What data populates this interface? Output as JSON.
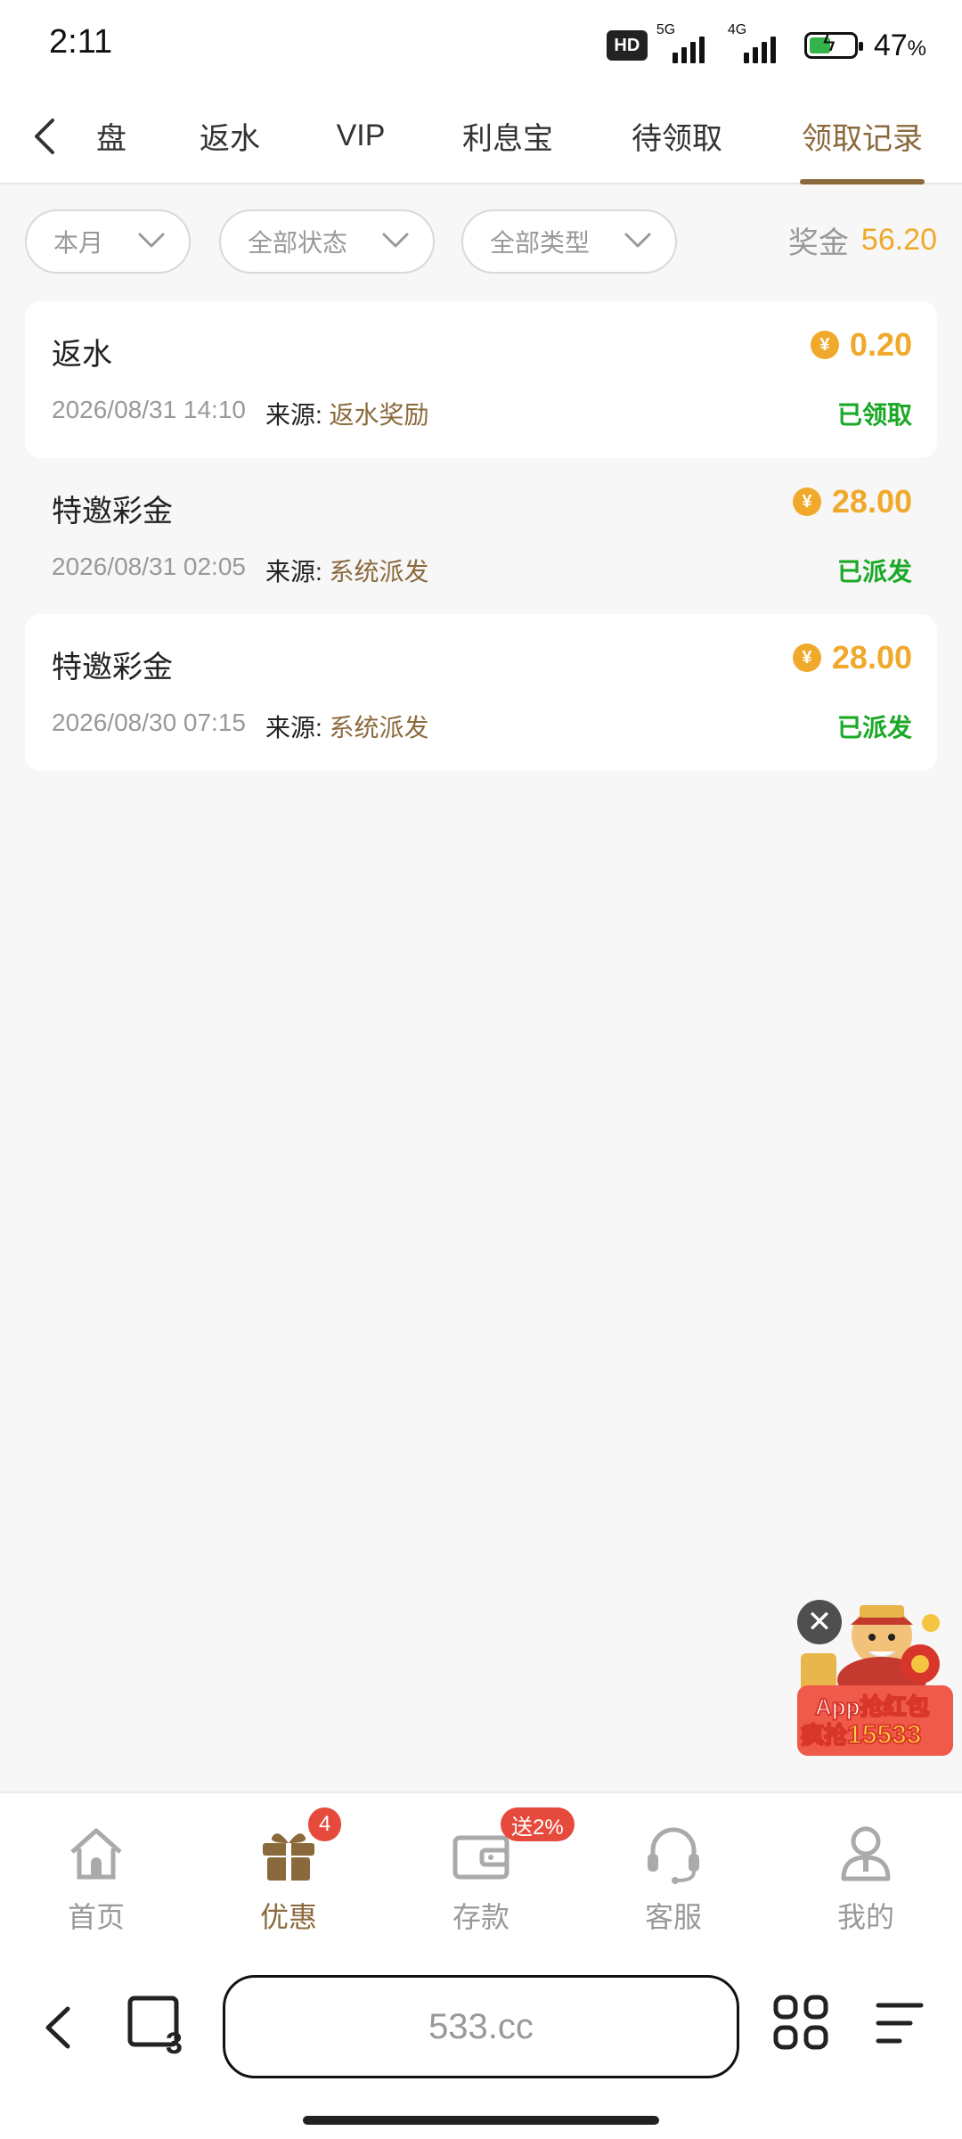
{
  "status_bar": {
    "time": "2:11",
    "hd_label": "HD",
    "net1": "5G",
    "net2": "4G",
    "battery_percent": "47",
    "battery_percent_unit": "%",
    "battery_level": 0.47
  },
  "tabs": [
    {
      "label": "盘",
      "active": false
    },
    {
      "label": "返水",
      "active": false
    },
    {
      "label": "VIP",
      "active": false
    },
    {
      "label": "利息宝",
      "active": false
    },
    {
      "label": "待领取",
      "active": false
    },
    {
      "label": "领取记录",
      "active": true
    }
  ],
  "filters": {
    "period": "本月",
    "status": "全部状态",
    "type": "全部类型",
    "bonus_label": "奖金",
    "bonus_value": "56.20"
  },
  "records": [
    {
      "title": "返水",
      "datetime": "2026/08/31 14:10",
      "source_label": "来源:",
      "source": "返水奖励",
      "amount": "0.20",
      "status": "已领取",
      "coin_symbol": "¥"
    },
    {
      "title": "特邀彩金",
      "datetime": "2026/08/31 02:05",
      "source_label": "来源:",
      "source": "系统派发",
      "amount": "28.00",
      "status": "已派发",
      "coin_symbol": "¥"
    },
    {
      "title": "特邀彩金",
      "datetime": "2026/08/30 07:15",
      "source_label": "来源:",
      "source": "系统派发",
      "amount": "28.00",
      "status": "已派发",
      "coin_symbol": "¥"
    }
  ],
  "promo": {
    "line1": "App抢红包",
    "line2_prefix": "疯抢",
    "line2_number": "15533",
    "close_glyph": "✕"
  },
  "bottom_nav": [
    {
      "label": "首页",
      "icon": "home-icon",
      "active": false
    },
    {
      "label": "优惠",
      "icon": "gift-icon",
      "active": true,
      "badge": "4"
    },
    {
      "label": "存款",
      "icon": "wallet-icon",
      "active": false,
      "badge": "送2%"
    },
    {
      "label": "客服",
      "icon": "headset-icon",
      "active": false
    },
    {
      "label": "我的",
      "icon": "user-icon",
      "active": false
    }
  ],
  "browser": {
    "url": "533.cc",
    "tab_count": "3"
  },
  "colors": {
    "accent_brown": "#8a6a3c",
    "gold": "#f0a92b",
    "success_green": "#1aa826",
    "badge_red": "#e54a3c"
  }
}
